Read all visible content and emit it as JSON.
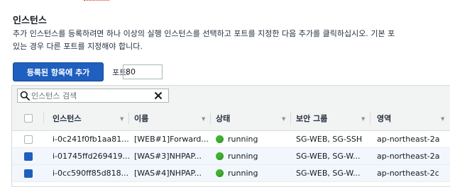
{
  "panel": {
    "title": "인스턴스",
    "description": "추가 인스턴스를 등록하려면 하나 이상의 실행 인스턴스를 선택하고 포트를 지정한 다음 추가를 클릭하십시오. 기본 포\n있는 경우 다른 포트를 지정해야 합니다.",
    "add_button": "등록된 항목에 추가",
    "port_label": "포트:",
    "port_value": "80"
  },
  "search": {
    "placeholder": "인스턴스 검색",
    "search_icon": "search-icon",
    "clear_icon": "close-icon"
  },
  "table": {
    "columns": [
      "인스턴스",
      "이름",
      "상태",
      "보안 그룹",
      "영역"
    ],
    "rows": [
      {
        "selected": false,
        "instance": "i-0c241f0fb1aa81...",
        "name": "[WEB#1]Forward...",
        "state": "running",
        "security_group": "SG-WEB, SG-SSH",
        "zone": "ap-northeast-2a"
      },
      {
        "selected": true,
        "instance": "i-01745ffd269419...",
        "name": "[WAS#3]NHPAP...",
        "state": "running",
        "security_group": "SG-WEB, SG-W...",
        "zone": "ap-northeast-2a"
      },
      {
        "selected": true,
        "instance": "i-0cc590ff85d818...",
        "name": "[WAS#4]NHPAP...",
        "state": "running",
        "security_group": "SG-WEB, SG-W...",
        "zone": "ap-northeast-2c"
      }
    ]
  },
  "colors": {
    "primary_button": "#1f5fbf",
    "running_status": "#3fb42e",
    "selected_row": "#f1f7fc"
  }
}
